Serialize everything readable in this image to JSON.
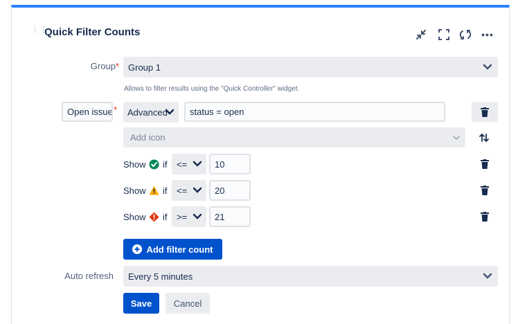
{
  "header": {
    "title": "Quick Filter Counts"
  },
  "form": {
    "group_label": "Group",
    "group_value": "Group 1",
    "group_help": "Allows to filter results using the \"Quick Controller\" widget.",
    "filter_name_value": "Open issues",
    "filter_type_value": "Advanced",
    "filter_query_value": "status = open",
    "add_icon_placeholder": "Add icon",
    "counts": [
      {
        "show": "Show",
        "if": "if",
        "icon": "check-circle-icon",
        "op": "<=",
        "value": "10"
      },
      {
        "show": "Show",
        "if": "if",
        "icon": "warning-icon",
        "op": "<=",
        "value": "20"
      },
      {
        "show": "Show",
        "if": "if",
        "icon": "error-icon",
        "op": ">=",
        "value": "21"
      }
    ],
    "add_filter_count_label": "Add filter count",
    "auto_refresh_label": "Auto refresh",
    "auto_refresh_value": "Every 5 minutes",
    "save_label": "Save",
    "cancel_label": "Cancel"
  },
  "colors": {
    "accent": "#2684ff",
    "primary": "#0052cc",
    "success": "#00875a",
    "warning": "#ffab00",
    "danger": "#de350b"
  }
}
